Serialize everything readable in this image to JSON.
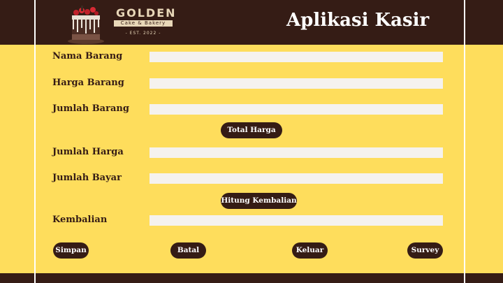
{
  "header": {
    "title": "Aplikasi Kasir",
    "logo": {
      "name": "GOLDEN",
      "tagline": "Cake & Bakery",
      "established": "- EST. 2022 -"
    }
  },
  "form": {
    "fields": [
      {
        "label": "Nama Barang",
        "value": "",
        "placeholder": ""
      },
      {
        "label": "Harga Barang",
        "value": "",
        "placeholder": ""
      },
      {
        "label": "Jumlah Barang",
        "value": "",
        "placeholder": ""
      },
      {
        "label": "Jumlah Harga",
        "value": "",
        "placeholder": ""
      },
      {
        "label": "Jumlah Bayar",
        "value": "",
        "placeholder": ""
      },
      {
        "label": "Kembalian",
        "value": "",
        "placeholder": ""
      }
    ],
    "total_button": "Total Harga",
    "change_button": "Hitung Kembalian"
  },
  "actions": {
    "save": "Simpan",
    "cancel": "Batal",
    "exit": "Keluar",
    "survey": "Survey"
  },
  "colors": {
    "background": "#fedd5c",
    "dark": "#351c15",
    "field": "#f5f2ee"
  }
}
